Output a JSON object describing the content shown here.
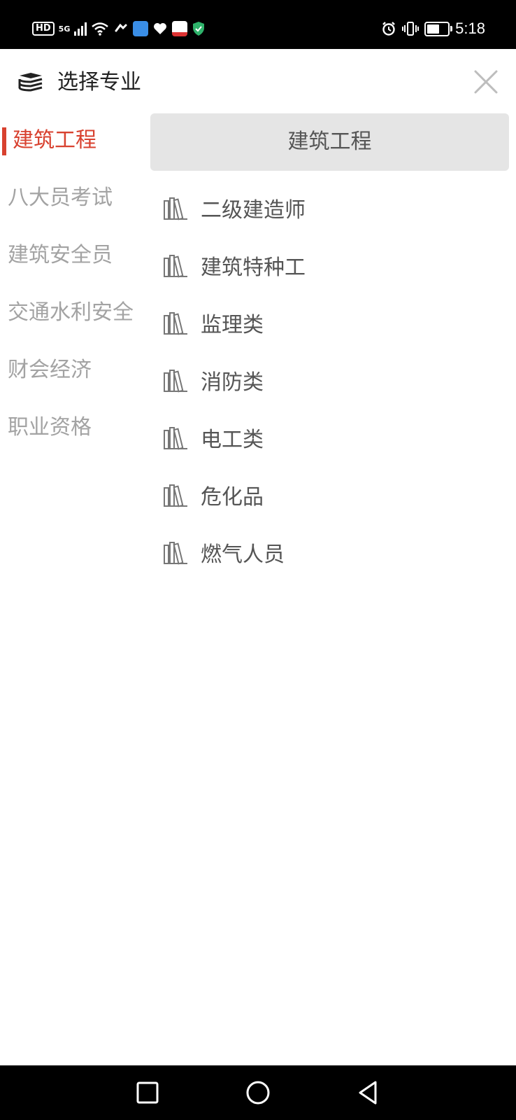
{
  "status_bar": {
    "hd": "HD",
    "net_5g": "5G",
    "time": "5:18",
    "battery_level": 0.6
  },
  "header": {
    "title": "选择专业",
    "icon": "books-stack-icon",
    "close_icon": "close-icon"
  },
  "categories": [
    {
      "label": "建筑工程",
      "active": true
    },
    {
      "label": "八大员考试",
      "active": false
    },
    {
      "label": "建筑安全员",
      "active": false
    },
    {
      "label": "交通水利安全",
      "active": false
    },
    {
      "label": "财会经济",
      "active": false
    },
    {
      "label": "职业资格",
      "active": false
    }
  ],
  "content": {
    "section_title": "建筑工程",
    "items": [
      {
        "label": "二级建造师",
        "icon": "books-icon"
      },
      {
        "label": "建筑特种工",
        "icon": "books-icon"
      },
      {
        "label": "监理类",
        "icon": "books-icon"
      },
      {
        "label": "消防类",
        "icon": "books-icon"
      },
      {
        "label": "电工类",
        "icon": "books-icon"
      },
      {
        "label": "危化品",
        "icon": "books-icon"
      },
      {
        "label": "燃气人员",
        "icon": "books-icon"
      }
    ]
  },
  "colors": {
    "accent": "#d8412f",
    "inactive_text": "#a3a3a3",
    "section_bg": "#e5e5e5"
  }
}
